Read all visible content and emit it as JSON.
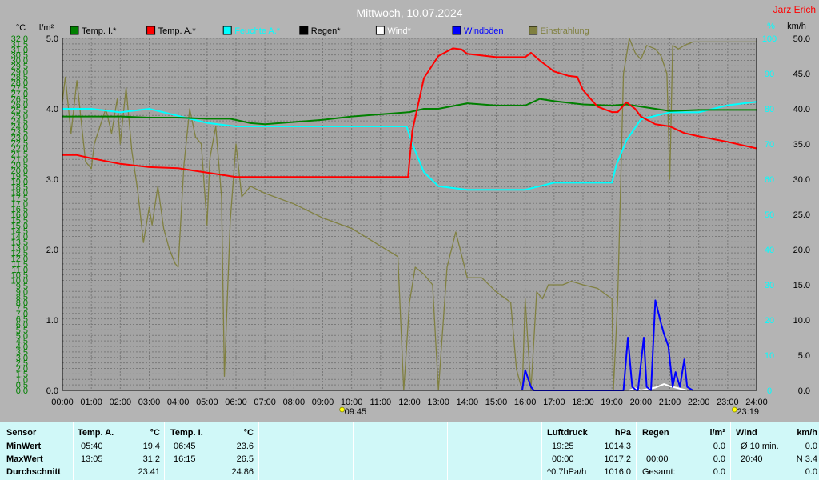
{
  "chart_data": {
    "type": "line",
    "title": "Mittwoch, 10.07.2024",
    "author": "Jarz Erich",
    "xlabel": "",
    "x_ticks": [
      "00:00",
      "01:00",
      "02:00",
      "03:00",
      "04:00",
      "05:00",
      "06:00",
      "07:00",
      "08:00",
      "09:00",
      "10:00",
      "11:00",
      "12:00",
      "13:00",
      "14:00",
      "15:00",
      "16:00",
      "17:00",
      "18:00",
      "19:00",
      "20:00",
      "21:00",
      "22:00",
      "23:00",
      "24:00"
    ],
    "xlim": [
      0,
      24
    ],
    "sun_events": {
      "sunrise": "09:45",
      "sunset": "23:19",
      "sunrise_h": 9.75,
      "sunset_h": 23.32
    },
    "axes": {
      "temp": {
        "unit": "°C",
        "lim": [
          0,
          32
        ],
        "step": 0.5
      },
      "rain": {
        "unit": "l/m²",
        "lim": [
          0,
          5
        ],
        "ticks": [
          "0.0",
          "1.0",
          "2.0",
          "3.0",
          "4.0",
          "5.0"
        ]
      },
      "humidity": {
        "unit": "%",
        "lim": [
          0,
          100
        ],
        "ticks": [
          "0",
          "10",
          "20",
          "30",
          "40",
          "50",
          "60",
          "70",
          "80",
          "90",
          "100"
        ]
      },
      "wind": {
        "unit": "km/h",
        "lim": [
          0,
          50
        ],
        "ticks": [
          "0.0",
          "5.0",
          "10.0",
          "15.0",
          "20.0",
          "25.0",
          "30.0",
          "35.0",
          "40.0",
          "45.0",
          "50.0"
        ]
      }
    },
    "legend": [
      {
        "name": "Temp. I.*",
        "color": "#008000"
      },
      {
        "name": "Temp. A.*",
        "color": "#ff0000"
      },
      {
        "name": "Feuchte A.*",
        "color": "#00ffff"
      },
      {
        "name": "Regen*",
        "color": "#000000"
      },
      {
        "name": "Wind*",
        "color": "#ffffff"
      },
      {
        "name": "Windböen",
        "color": "#0000ff"
      },
      {
        "name": "Einstrahlung",
        "color": "#808040"
      }
    ],
    "series": [
      {
        "name": "Temp. I.*",
        "axis": "temp",
        "color": "#008000",
        "x": [
          0,
          1,
          2,
          3,
          4,
          5,
          5.8,
          6.5,
          7,
          8,
          9,
          10,
          11,
          12,
          12.5,
          13,
          14,
          15,
          16,
          16.5,
          17,
          18,
          19,
          19.5,
          20,
          21,
          22,
          23,
          24
        ],
        "y": [
          24.9,
          24.9,
          24.9,
          24.8,
          24.8,
          24.7,
          24.7,
          24.3,
          24.2,
          24.4,
          24.6,
          24.9,
          25.1,
          25.3,
          25.6,
          25.6,
          26.1,
          25.9,
          25.9,
          26.5,
          26.3,
          26.0,
          25.9,
          26.0,
          25.8,
          25.4,
          25.5,
          25.5,
          25.5
        ]
      },
      {
        "name": "Temp. A.*",
        "axis": "temp",
        "color": "#ff0000",
        "x": [
          0,
          0.5,
          1,
          2,
          3,
          4,
          5,
          6,
          7,
          8,
          9,
          10,
          11,
          11.95,
          12.1,
          12.5,
          13,
          13.5,
          13.8,
          14,
          15,
          16,
          16.2,
          16.5,
          17,
          17.5,
          17.8,
          18,
          18.5,
          19,
          19.2,
          19.5,
          19.8,
          20,
          20.5,
          21,
          21.5,
          22,
          23,
          24
        ],
        "y": [
          21.4,
          21.4,
          21.1,
          20.6,
          20.3,
          20.2,
          19.8,
          19.4,
          19.4,
          19.4,
          19.4,
          19.4,
          19.4,
          19.4,
          23.6,
          28.4,
          30.4,
          31.1,
          31.0,
          30.6,
          30.3,
          30.3,
          30.7,
          30.0,
          29.0,
          28.6,
          28.5,
          27.3,
          25.8,
          25.3,
          25.3,
          26.2,
          25.6,
          24.9,
          24.2,
          24.0,
          23.4,
          23.1,
          22.6,
          22.0
        ]
      },
      {
        "name": "Feuchte A.*",
        "axis": "humidity",
        "color": "#00ffff",
        "x": [
          0,
          1,
          2,
          3,
          4,
          5,
          6,
          7,
          8,
          9,
          10,
          11,
          11.9,
          12.1,
          12.5,
          13,
          14,
          15,
          16,
          17,
          18,
          19,
          19.15,
          19.5,
          20,
          21,
          22,
          23,
          24
        ],
        "y": [
          80,
          80,
          79,
          80,
          78,
          76,
          75,
          75,
          75,
          75,
          75,
          75,
          75,
          70,
          62,
          58,
          57,
          57,
          57,
          59,
          59,
          59,
          64,
          71,
          77,
          79,
          79,
          81,
          82
        ]
      },
      {
        "name": "Windböen",
        "axis": "wind",
        "color": "#0000ff",
        "x": [
          15.9,
          16.0,
          16.2,
          16.3,
          19.4,
          19.55,
          19.7,
          19.85,
          19.9,
          20.1,
          20.2,
          20.35,
          20.5,
          20.7,
          20.8,
          20.95,
          21.1,
          21.2,
          21.35,
          21.5,
          21.6,
          21.8
        ],
        "y": [
          0,
          2.9,
          0.5,
          0,
          0,
          7.5,
          0.5,
          0,
          0,
          7.5,
          0.5,
          0,
          12.8,
          9.5,
          8.0,
          6.3,
          0.5,
          2.6,
          0.5,
          4.4,
          0.5,
          0
        ]
      },
      {
        "name": "Wind*",
        "axis": "wind",
        "color": "#ffffff",
        "x": [
          19.6,
          19.8,
          20.0,
          20.5,
          20.8,
          21.0,
          21.3,
          21.6
        ],
        "y": [
          0,
          0.3,
          0,
          0.4,
          0.9,
          0.6,
          0.3,
          0
        ]
      },
      {
        "name": "Einstrahlung",
        "axis": "humidity",
        "color": "#808040",
        "x": [
          0,
          0.1,
          0.3,
          0.5,
          0.8,
          1.0,
          1.1,
          1.3,
          1.5,
          1.7,
          1.9,
          2.0,
          2.2,
          2.4,
          2.6,
          2.8,
          3.0,
          3.1,
          3.3,
          3.5,
          3.7,
          3.9,
          4.0,
          4.2,
          4.4,
          4.6,
          4.8,
          5.0,
          5.1,
          5.3,
          5.5,
          5.6,
          5.8,
          6.0,
          6.2,
          6.5,
          7,
          8,
          9,
          10,
          11,
          11.6,
          11.8,
          12.0,
          12.2,
          12.5,
          12.8,
          13.0,
          13.3,
          13.6,
          14.0,
          14.5,
          15.0,
          15.5,
          15.7,
          15.9,
          16.0,
          16.2,
          16.4,
          16.6,
          16.8,
          17.0,
          17.3,
          17.6,
          18.0,
          18.5,
          19.0,
          19.05,
          19.2,
          19.4,
          19.6,
          19.8,
          20.0,
          20.2,
          20.5,
          20.7,
          20.9,
          21.0,
          21.1,
          21.3,
          21.5,
          21.8,
          22,
          23,
          24
        ],
        "y": [
          82,
          89,
          73,
          88,
          65,
          63,
          70,
          75,
          80,
          73,
          83,
          70,
          86,
          68,
          57,
          42,
          52,
          47,
          58,
          46,
          40,
          36,
          35,
          64,
          80,
          72,
          70,
          47,
          66,
          75,
          55,
          4,
          48,
          70,
          55,
          58,
          56,
          53,
          49,
          46,
          41,
          38,
          0,
          25,
          35,
          33,
          30,
          0,
          35,
          45,
          32,
          32,
          28,
          25,
          6,
          0,
          26,
          0,
          28,
          26,
          30,
          30,
          30,
          31,
          30,
          29,
          26,
          0,
          26,
          90,
          100,
          96,
          94,
          98,
          97,
          95,
          90,
          60,
          98,
          97,
          98,
          99,
          99,
          99,
          99
        ]
      }
    ]
  },
  "panel": {
    "sensor": {
      "header": "Sensor",
      "rows": [
        "MinWert",
        "MaxWert",
        "Durchschnitt"
      ]
    },
    "temp_a": {
      "header": "Temp. A.",
      "unit": "°C",
      "min_time": "05:40",
      "min_val": "19.4",
      "max_time": "13:05",
      "max_val": "31.2",
      "avg": "23.41"
    },
    "temp_i": {
      "header": "Temp. I.",
      "unit": "°C",
      "min_time": "06:45",
      "min_val": "23.6",
      "max_time": "16:15",
      "max_val": "26.5",
      "avg": "24.86"
    },
    "pressure": {
      "header": "Luftdruck",
      "unit": "hPa",
      "min_time": "19:25",
      "min_val": "1014.3",
      "max_time": "00:00",
      "max_val": "1017.2",
      "trend": "^0.7hPa/h",
      "avg": "1016.0"
    },
    "rain": {
      "header": "Regen",
      "unit": "l/m²",
      "max_time": "00:00",
      "max_val": "0.0",
      "total_label": "Gesamt:",
      "total": "0.0",
      "min_val": "0.0"
    },
    "wind": {
      "header": "Wind",
      "unit": "km/h",
      "avg_label": "Ø 10 min.",
      "avg_val": "0.0",
      "max_time": "20:40",
      "max_val": "N 3.4",
      "day_val": "0.0"
    }
  },
  "colors": {
    "background": "#b4b4b4",
    "plot": "#a4a4a4",
    "panel": "#d0f8f8",
    "temp_axis": "#008000",
    "humidity_axis": "#00ffff",
    "title": "#ffffff",
    "author": "#ff0000"
  }
}
